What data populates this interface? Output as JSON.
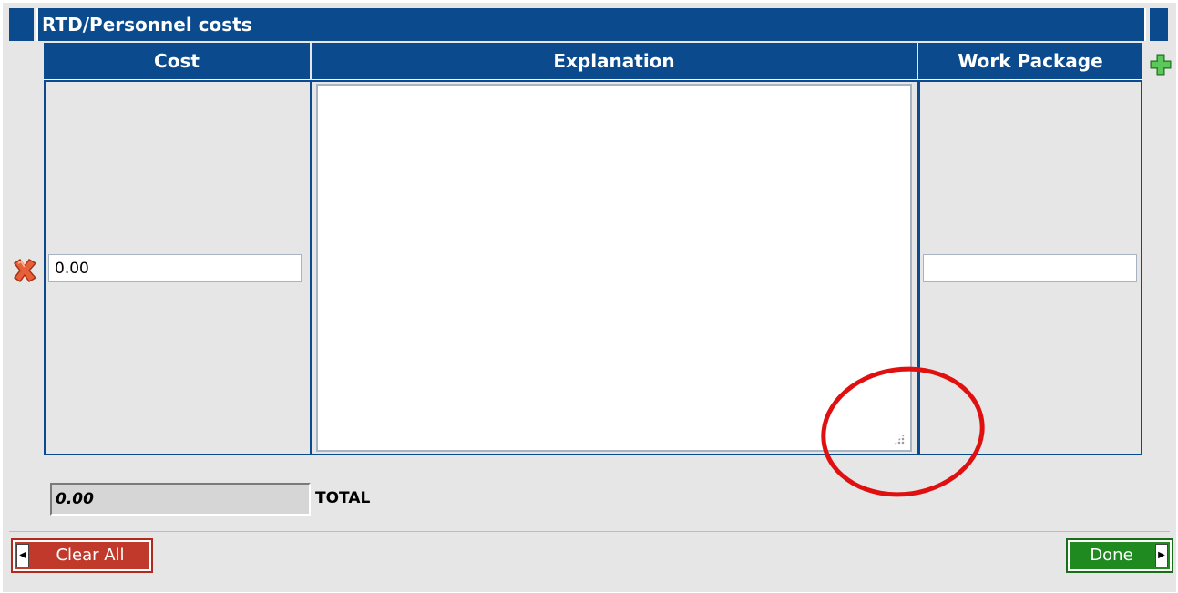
{
  "section": {
    "title": "RTD/Personnel costs"
  },
  "table": {
    "columns": [
      "Cost",
      "Explanation",
      "Work Package"
    ],
    "rows": [
      {
        "cost": "0.00",
        "explanation": "",
        "work_package": ""
      }
    ]
  },
  "total": {
    "value": "0.00",
    "label": "TOTAL"
  },
  "buttons": {
    "clear_all": "Clear All",
    "done": "Done"
  },
  "icons": {
    "add_row": "plus-icon",
    "delete_row": "delete-x-icon"
  },
  "colors": {
    "header": "#0b4a8c",
    "clear": "#c0392b",
    "done": "#1f8a1f",
    "annotation": "#e01010"
  }
}
